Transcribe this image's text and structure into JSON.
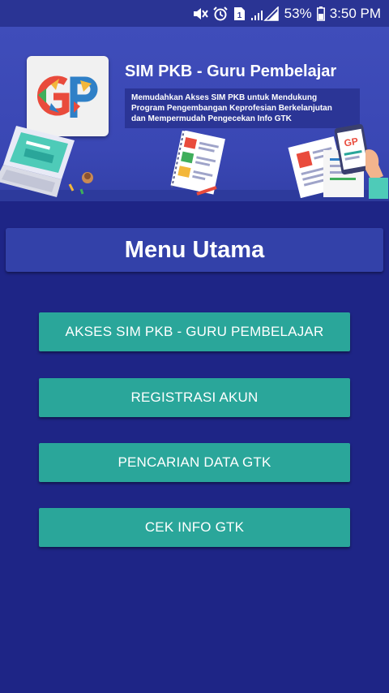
{
  "status_bar": {
    "battery_percent": "53%",
    "time": "3:50 PM",
    "icons": [
      "mute-icon",
      "alarm-icon",
      "sim-icon",
      "signal-icon",
      "battery-icon"
    ]
  },
  "banner": {
    "logo_text": "GP",
    "title": "SIM PKB - Guru Pembelajar",
    "description_lines": [
      "Memudahkan Akses SIM PKB untuk Mendukung",
      "Program Pengembangan Keprofesian Berkelanjutan",
      "dan Mempermudah Pengecekan Info GTK"
    ],
    "phone_logo_text": "GP"
  },
  "menu": {
    "title": "Menu Utama",
    "buttons": [
      {
        "label": "AKSES SIM PKB - GURU PEMBELAJAR"
      },
      {
        "label": "REGISTRASI AKUN"
      },
      {
        "label": "PENCARIAN DATA GTK"
      },
      {
        "label": "CEK INFO GTK"
      }
    ]
  },
  "colors": {
    "background": "#1e2586",
    "banner": "#3f4dba",
    "button": "#2aa69a",
    "title_box": "#3341a9"
  }
}
